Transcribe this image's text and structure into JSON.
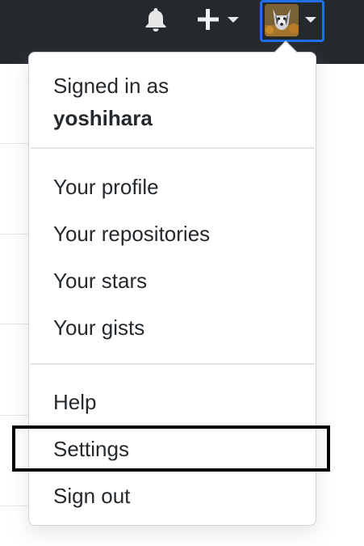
{
  "header": {
    "notifications_icon": "bell-icon",
    "create_icon": "plus-icon",
    "create_caret_icon": "caret-down-icon",
    "avatar_caret_icon": "caret-down-icon",
    "background_color": "#24292e",
    "avatar_focus_color": "#1f6feb"
  },
  "user_menu": {
    "signed_in_label": "Signed in as",
    "username": "yoshihara",
    "groups": [
      {
        "items": [
          "Your profile",
          "Your repositories",
          "Your stars",
          "Your gists"
        ]
      },
      {
        "items": [
          "Help",
          "Settings",
          "Sign out"
        ]
      }
    ],
    "highlighted_item": "Settings"
  }
}
